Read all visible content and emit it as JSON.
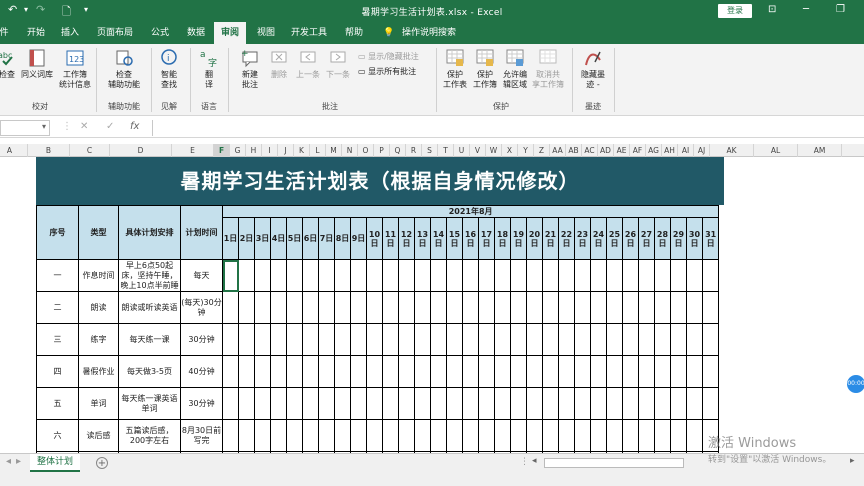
{
  "window": {
    "title": "暑期学习生活计划表.xlsx  -  Excel",
    "login_label": "登录"
  },
  "tabs": [
    "件",
    "开始",
    "插入",
    "页面布局",
    "公式",
    "数据",
    "审阅",
    "视图",
    "开发工具",
    "帮助",
    "操作说明搜索"
  ],
  "ribbon": {
    "proofing": {
      "spell": "检查",
      "thesaurus": "同义词库",
      "stats_line1": "工作簿",
      "stats_line2": "统计信息",
      "group": "校对"
    },
    "accessibility": {
      "check_line1": "检查",
      "check_line2": "辅助功能",
      "group": "辅助功能"
    },
    "insights": {
      "lookup_line1": "智能",
      "lookup_line2": "查找",
      "group": "见解"
    },
    "language": {
      "translate_line1": "翻",
      "translate_line2": "译",
      "group": "语言"
    },
    "comments": {
      "new_line1": "新建",
      "new_line2": "批注",
      "delete": "删除",
      "prev": "上一条",
      "next": "下一条",
      "show_hide": "显示/隐藏批注",
      "show_all": "显示所有批注",
      "group": "批注"
    },
    "protect": {
      "sheet_line1": "保护",
      "sheet_line2": "工作表",
      "book_line1": "保护",
      "book_line2": "工作簿",
      "ranges_line1": "允许编",
      "ranges_line2": "辑区域",
      "unshare_line1": "取消共",
      "unshare_line2": "享工作簿",
      "group": "保护"
    },
    "ink": {
      "hide_line1": "隐藏墨",
      "hide_line2": "迹 -",
      "group": "墨迹"
    }
  },
  "formula_bar": {
    "fx": "fx",
    "cancel": "✕",
    "enter": "✓"
  },
  "columns": [
    "A",
    "B",
    "C",
    "D",
    "E",
    "F",
    "G",
    "H",
    "I",
    "J",
    "K",
    "L",
    "M",
    "N",
    "O",
    "P",
    "Q",
    "R",
    "S",
    "T",
    "U",
    "V",
    "W",
    "X",
    "Y",
    "Z",
    "AA",
    "AB",
    "AC",
    "AD",
    "AE",
    "AF",
    "AG",
    "AH",
    "AI",
    "AJ",
    "AK",
    "AL",
    "AM"
  ],
  "sheet": {
    "title": "暑期学习生活计划表（根据自身情况修改）",
    "headers": {
      "seq": "序号",
      "type": "类型",
      "detail": "具体计划安排",
      "time": "计划时间",
      "month": "2021年8月"
    },
    "days": [
      "1日",
      "2日",
      "3日",
      "4日",
      "5日",
      "6日",
      "7日",
      "8日",
      "9日",
      "10日",
      "11日",
      "12日",
      "13日",
      "14日",
      "15日",
      "16日",
      "17日",
      "18日",
      "19日",
      "20日",
      "21日",
      "22日",
      "23日",
      "24日",
      "25日",
      "26日",
      "27日",
      "28日",
      "29日",
      "30日",
      "31日"
    ],
    "rows": [
      {
        "seq": "一",
        "type": "作息时间",
        "detail": "早上6点50起床，坚持午睡，晚上10点半前睡",
        "time": "每天"
      },
      {
        "seq": "二",
        "type": "朗读",
        "detail": "朗读或听读英语",
        "time": "(每天)30分钟"
      },
      {
        "seq": "三",
        "type": "练字",
        "detail": "每天练一课",
        "time": "30分钟"
      },
      {
        "seq": "四",
        "type": "暑假作业",
        "detail": "每天做3-5页",
        "time": "40分钟"
      },
      {
        "seq": "五",
        "type": "单词",
        "detail": "每天练一课英语单词",
        "time": "30分钟"
      },
      {
        "seq": "六",
        "type": "读后感",
        "detail": "五篇读后感，200字左右",
        "time": "8月30日前写完"
      }
    ]
  },
  "sheet_tabs": {
    "active": "整体计划",
    "add": "+"
  },
  "watermark": {
    "line1": "激活 Windows",
    "line2": "转到\"设置\"以激活 Windows。"
  },
  "float_badge": "00:00"
}
